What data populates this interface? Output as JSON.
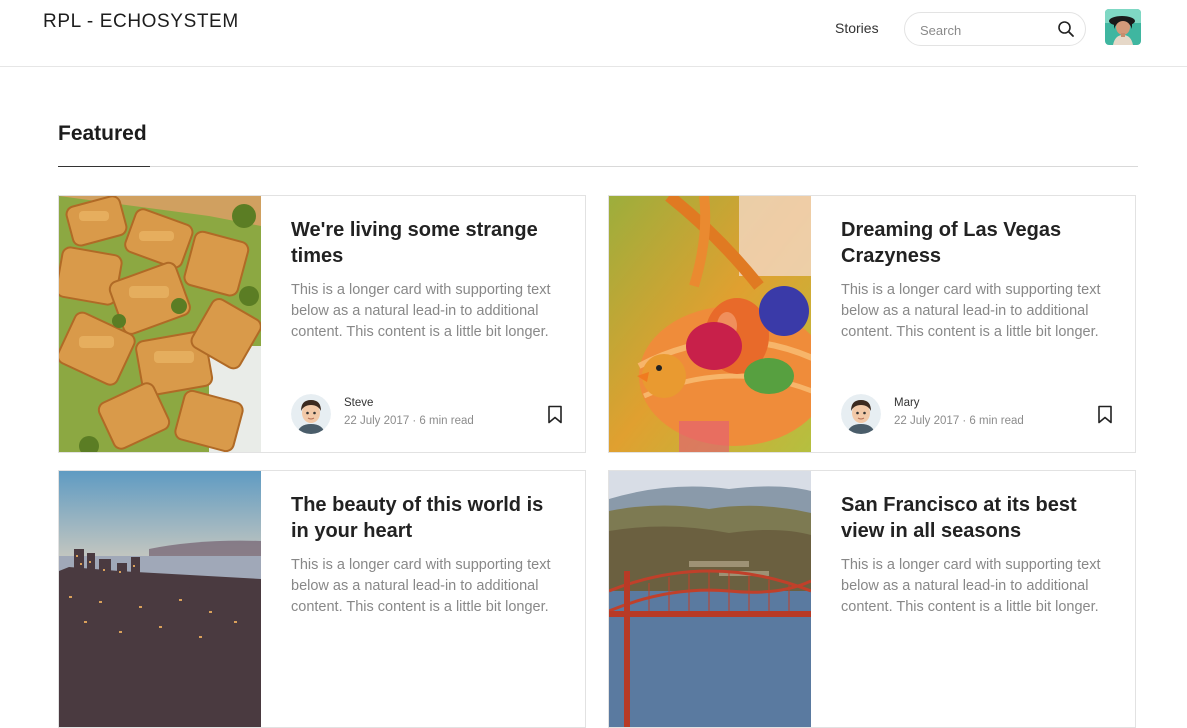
{
  "header": {
    "brand": "RPL - ECHOSYSTEM",
    "nav_stories": "Stories",
    "search_placeholder": "Search"
  },
  "section": {
    "title": "Featured"
  },
  "cards": [
    {
      "title": "We're living some strange times",
      "text": "This is a longer card with supporting text below as a natural lead-in to additional content. This content is a little bit longer.",
      "author": "Steve",
      "meta": "22 July 2017 · 6 min read"
    },
    {
      "title": "Dreaming of Las Vegas Crazyness",
      "text": "This is a longer card with supporting text below as a natural lead-in to additional content. This content is a little bit longer.",
      "author": "Mary",
      "meta": "22 July 2017 · 6 min read"
    },
    {
      "title": "The beauty of this world is in your heart",
      "text": "This is a longer card with supporting text below as a natural lead-in to additional content. This content is a little bit longer."
    },
    {
      "title": "San Francisco at its best view in all seasons",
      "text": "This is a longer card with supporting text below as a natural lead-in to additional content. This content is a little bit longer."
    }
  ],
  "icons": {
    "search": "search-icon",
    "bookmark": "bookmark-icon",
    "profile": "profile-avatar"
  },
  "colors": {
    "text_primary": "#222222",
    "text_muted": "#888888",
    "border": "#e2e2e2"
  }
}
